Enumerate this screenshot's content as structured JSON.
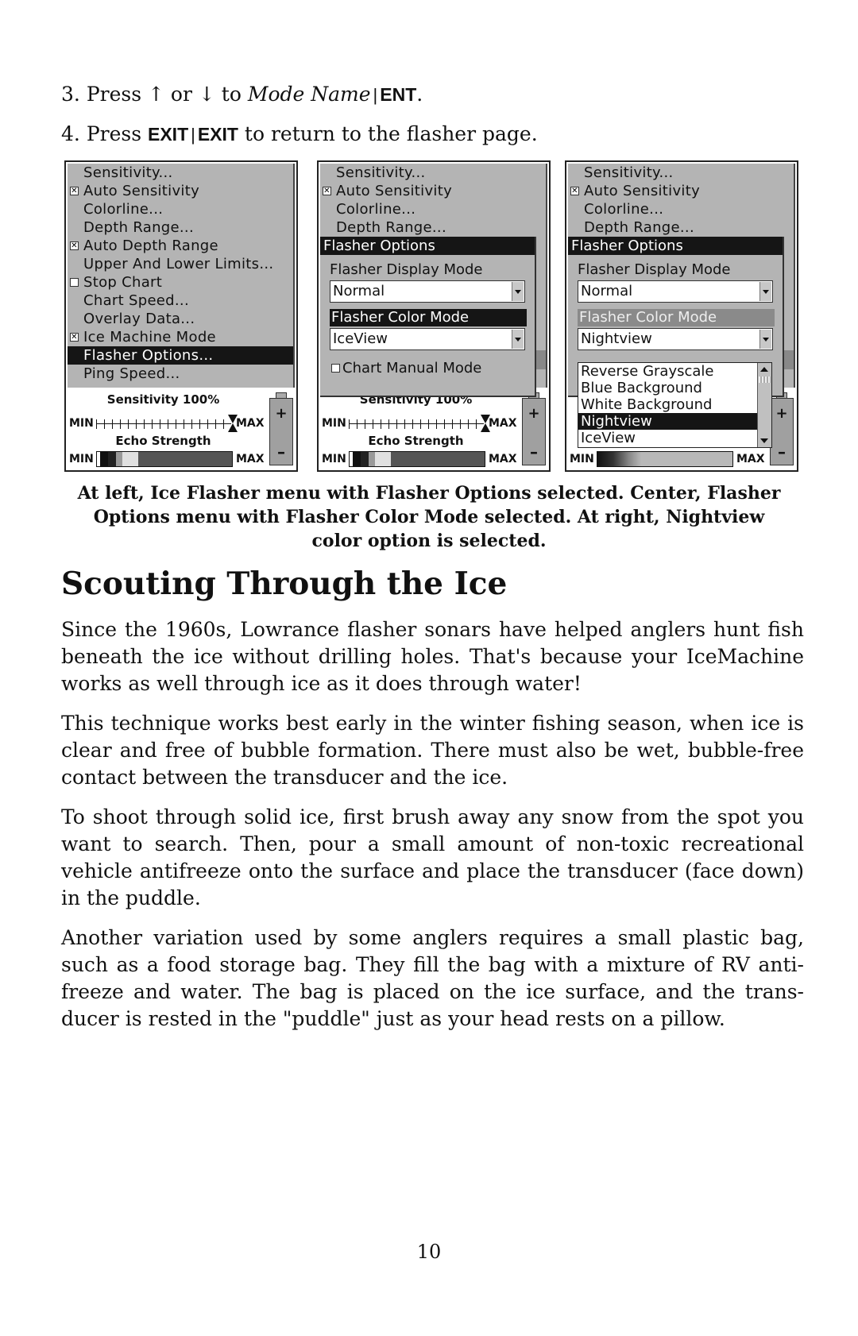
{
  "steps": [
    {
      "number": "3.",
      "text_pre": "Press",
      "up_arrow": "↑",
      "or": "or",
      "down_arrow": "↓",
      "to": "to",
      "target": "Mode Name",
      "sep": "|",
      "key": "ENT",
      "end": "."
    },
    {
      "number": "4.",
      "text_pre": "Press",
      "key1": "EXIT",
      "sep": "|",
      "key2": "EXIT",
      "text_post": "to return to the flasher page."
    }
  ],
  "screens": {
    "left": {
      "menu_items": [
        {
          "label": "Sensitivity...",
          "checkbox": null
        },
        {
          "label": "Auto Sensitivity",
          "checkbox": "checked"
        },
        {
          "label": "Colorline...",
          "checkbox": null
        },
        {
          "label": "Depth Range...",
          "checkbox": null
        },
        {
          "label": "Auto Depth Range",
          "checkbox": "checked"
        },
        {
          "label": "Upper And Lower Limits...",
          "checkbox": null
        },
        {
          "label": "Stop Chart",
          "checkbox": "unchecked"
        },
        {
          "label": "Chart Speed...",
          "checkbox": null
        },
        {
          "label": "Overlay Data...",
          "checkbox": null
        },
        {
          "label": "Ice Machine Mode",
          "checkbox": "checked"
        },
        {
          "label": "Flasher Options...",
          "checkbox": null,
          "selected": true
        },
        {
          "label": "Ping Speed...",
          "checkbox": null
        }
      ],
      "sensitivity_label": "Sensitivity 100%",
      "sensitivity_value": 100,
      "echo_label": "Echo Strength",
      "min": "MIN",
      "max": "MAX",
      "plus": "+",
      "minus": "–"
    },
    "center": {
      "menu_items": [
        "Sensitivity...",
        "Auto Sensitivity",
        "Colorline...",
        "Depth Range..."
      ],
      "popup_title": "Flasher Options",
      "display_mode_label": "Flasher Display Mode",
      "display_mode_value": "Normal",
      "color_mode_label": "Flasher Color Mode",
      "color_mode_value": "IceView",
      "chart_manual_label": "Chart Manual Mode",
      "chart_manual_checked": false,
      "sensitivity_label": "Sensitivity 100%",
      "echo_label": "Echo Strength",
      "min": "MIN",
      "max": "MAX",
      "plus": "+",
      "minus": "–"
    },
    "right": {
      "menu_items": [
        "Sensitivity...",
        "Auto Sensitivity",
        "Colorline...",
        "Depth Range..."
      ],
      "popup_title": "Flasher Options",
      "display_mode_label": "Flasher Display Mode",
      "display_mode_value": "Normal",
      "color_mode_label": "Flasher Color Mode",
      "color_mode_value": "Nightview",
      "color_options": [
        "Reverse Grayscale",
        "Blue Background",
        "White Background",
        "Nightview",
        "IceView"
      ],
      "selected_option": "Nightview",
      "min": "MIN",
      "max": "MAX",
      "plus": "+",
      "minus": "–"
    }
  },
  "caption": "At left, Ice Flasher menu with Flasher Options selected. Center, Flasher Options menu with Flasher Color Mode selected. At right, Nightview color option is selected.",
  "section_title": "Scouting Through the Ice",
  "paragraphs": [
    "Since the 1960s, Lowrance flasher sonars have helped anglers hunt fish beneath the ice without drilling holes. That's because your IceMachine works as well through ice as it does through water!",
    "This technique works best early in the winter fishing season, when ice is clear and free of bubble formation. There must also be wet, bubble-free contact between the transducer and the ice.",
    "To shoot through solid ice, first brush away any snow from the spot you want to search. Then, pour a small amount of non-toxic recreational vehicle antifreeze onto the surface and place the transducer (face down) in the puddle.",
    "Another variation used by some anglers requires a small plastic bag, such as a food storage bag. They fill the bag with a mixture of RV anti-freeze and water. The bag is placed on the ice surface, and the trans-ducer is rested in the \"puddle\" just as your head rests on a pillow."
  ],
  "page_number": "10"
}
